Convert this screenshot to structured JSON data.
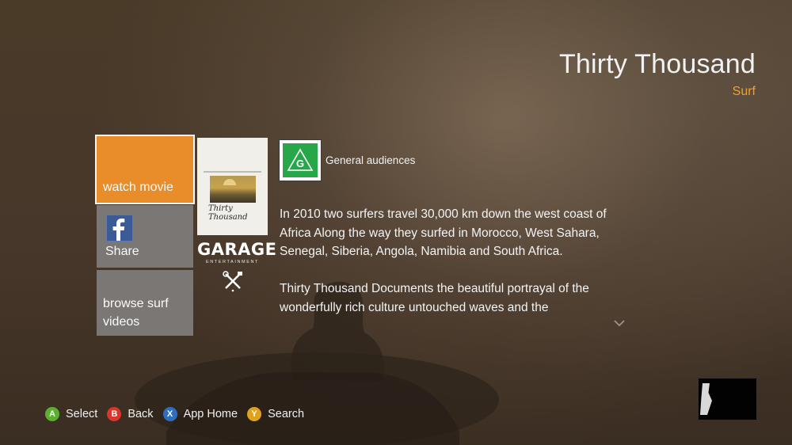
{
  "movie": {
    "title": "Thirty Thousand",
    "genre": "Surf"
  },
  "tiles": {
    "watch_label": "watch movie",
    "share_label": "Share",
    "browse_label": "browse surf videos"
  },
  "poster": {
    "title_text": "Thirty Thousand",
    "studio_name": "GARAGE",
    "studio_sub": "ENTERTAINMENT"
  },
  "rating": {
    "letter": "G",
    "label": "General audiences"
  },
  "description": {
    "paragraph_1": "In 2010 two surfers travel 30,000 km down the west coast of Africa Along the way they surfed in Morocco, West Sahara, Senegal, Siberia, Angola, Namibia and South Africa.",
    "paragraph_2": "Thirty Thousand Documents the beautiful portrayal of the wonderfully rich culture untouched waves and the"
  },
  "hints": [
    {
      "button": "A",
      "label": "Select",
      "color": "#5cb030"
    },
    {
      "button": "B",
      "label": "Back",
      "color": "#d9352b"
    },
    {
      "button": "X",
      "label": "App Home",
      "color": "#2f6ebf"
    },
    {
      "button": "Y",
      "label": "Search",
      "color": "#e0a21c"
    }
  ],
  "icons": {
    "share": "facebook-icon",
    "scroll": "chevron-down-icon",
    "rating": "g-rating-icon",
    "emblem": "crossed-tools-icon"
  },
  "colors": {
    "accent": "#e88d2a",
    "genre": "#f0a030",
    "rating_green": "#27a74a",
    "tile_gray": "#7a7774"
  }
}
